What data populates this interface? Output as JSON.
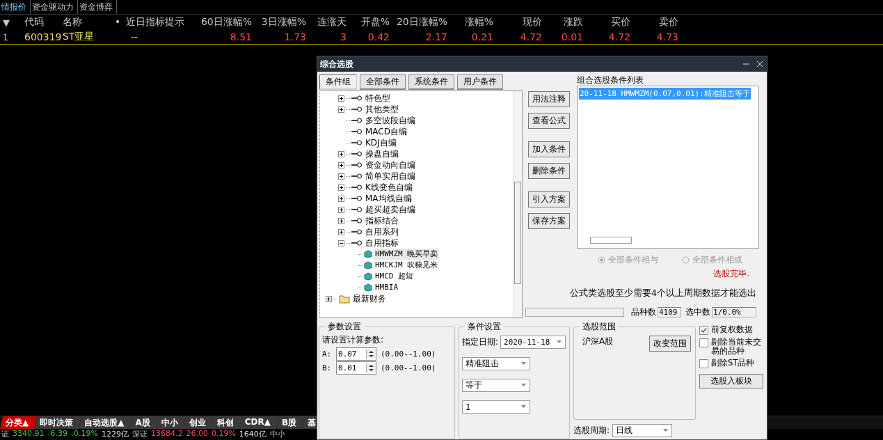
{
  "top_tabs": [
    {
      "label": "情报价",
      "selected": true
    },
    {
      "label": "资金驱动力",
      "selected": false
    },
    {
      "label": "资金博弈",
      "selected": false
    }
  ],
  "table": {
    "sort_marker": "▼",
    "columns": [
      {
        "label": "代码"
      },
      {
        "label": "名称"
      },
      {
        "label": "近日指标提示",
        "marker": "•"
      },
      {
        "label": "60日涨幅%"
      },
      {
        "label": "3日涨幅%"
      },
      {
        "label": "连涨天"
      },
      {
        "label": "开盘%"
      },
      {
        "label": "20日涨幅%"
      },
      {
        "label": "涨幅%"
      },
      {
        "label": "现价"
      },
      {
        "label": "涨跌"
      },
      {
        "label": "买价"
      },
      {
        "label": "卖价"
      }
    ],
    "rows": [
      {
        "index": "1",
        "cells": [
          {
            "text": "600319",
            "kind": "code"
          },
          {
            "text": "ST亚星",
            "kind": "name"
          },
          {
            "text": "--",
            "kind": "hint"
          },
          {
            "text": "8.51",
            "kind": "up"
          },
          {
            "text": "1.73",
            "kind": "up"
          },
          {
            "text": "3",
            "kind": "up"
          },
          {
            "text": "0.42",
            "kind": "up"
          },
          {
            "text": "2.17",
            "kind": "up"
          },
          {
            "text": "0.21",
            "kind": "up"
          },
          {
            "text": "4.72",
            "kind": "up"
          },
          {
            "text": "0.01",
            "kind": "up"
          },
          {
            "text": "4.72",
            "kind": "up"
          },
          {
            "text": "4.73",
            "kind": "up"
          }
        ]
      }
    ]
  },
  "bottom_tabs": [
    {
      "label": "分类▲",
      "selected": true
    },
    {
      "label": "即时决策",
      "selected": false
    },
    {
      "label": "自动选股▲",
      "selected": false
    },
    {
      "label": "A股",
      "selected": false
    },
    {
      "label": "中小",
      "selected": false
    },
    {
      "label": "创业",
      "selected": false
    },
    {
      "label": "科创",
      "selected": false
    },
    {
      "label": "CDR▲",
      "selected": false
    },
    {
      "label": "B股",
      "selected": false
    },
    {
      "label": "基",
      "selected": false
    }
  ],
  "status_bar": [
    {
      "text": "证",
      "kind": "label"
    },
    {
      "text": "3340.91",
      "kind": "down"
    },
    {
      "text": "-6.39",
      "kind": "down"
    },
    {
      "text": "-0.19%",
      "kind": "down"
    },
    {
      "text": "1229亿",
      "kind": "amount"
    },
    {
      "text": "深证",
      "kind": "label"
    },
    {
      "text": "13684.2",
      "kind": "up"
    },
    {
      "text": "26.00",
      "kind": "up"
    },
    {
      "text": "0.19%",
      "kind": "up"
    },
    {
      "text": "1640亿",
      "kind": "amount"
    },
    {
      "text": "中小",
      "kind": "label"
    }
  ],
  "dialog": {
    "title": "综合选股",
    "tabs": [
      {
        "label": "条件组",
        "selected": true
      },
      {
        "label": "全部条件",
        "selected": false
      },
      {
        "label": "系统条件",
        "selected": false
      },
      {
        "label": "用户条件",
        "selected": false
      }
    ],
    "tree": {
      "items": [
        {
          "children": [
            {
              "label": "特色型",
              "kind": "key",
              "expanded": false
            },
            {
              "label": "其他类型",
              "kind": "key",
              "expanded": false
            },
            {
              "label": "多空波段自编",
              "kind": "key"
            },
            {
              "label": "MACD自编",
              "kind": "key"
            },
            {
              "label": "KDJ自编",
              "kind": "key"
            },
            {
              "label": "操盘自编",
              "kind": "key",
              "expanded": false
            },
            {
              "label": "资金动向自编",
              "kind": "key",
              "expanded": false
            },
            {
              "label": "简单实用自编",
              "kind": "key",
              "expanded": false
            },
            {
              "label": "K线变色自编",
              "kind": "key",
              "expanded": false
            },
            {
              "label": "MA均线自编",
              "kind": "key",
              "expanded": false
            },
            {
              "label": "超买超卖自编",
              "kind": "key",
              "expanded": false
            },
            {
              "label": "指标结合",
              "kind": "key",
              "expanded": false
            },
            {
              "label": "自用系列",
              "kind": "key",
              "expanded": false
            },
            {
              "label": "自用指标",
              "kind": "key",
              "expanded": true,
              "children": [
                {
                  "label": "HMWMZM 晚买早卖",
                  "kind": "formula",
                  "selected": true
                },
                {
                  "label": "HMCKJM 吹糠见米",
                  "kind": "formula",
                  "selected": false
                },
                {
                  "label": "HMCD 超短",
                  "kind": "formula",
                  "selected": false
                },
                {
                  "label": "HMBIA",
                  "kind": "formula",
                  "selected": false
                }
              ]
            }
          ]
        },
        {
          "label": "最新财务",
          "kind": "folder",
          "expanded": false
        }
      ]
    },
    "buttons": [
      {
        "label": "用法注释"
      },
      {
        "label": "查看公式"
      },
      {
        "label": "加入条件"
      },
      {
        "label": "删除条件"
      },
      {
        "label": "引入方案"
      },
      {
        "label": "保存方案"
      }
    ],
    "condition_list": {
      "title": "组合选股条件列表",
      "items": [
        {
          "text": "20-11-18 HMWMZM(0.07,0.01):精准阻击等于",
          "selected": true
        }
      ]
    },
    "logic": [
      {
        "label": "全部条件相与",
        "selected": true
      },
      {
        "label": "全部条件相或",
        "selected": false
      }
    ],
    "status": "选股完毕.",
    "note": "公式类选股至少需要4个以上周期数据才能选出",
    "count_label": "品种数",
    "count": "4109",
    "selected_label": "选中数",
    "selected_count": "1/0.0%",
    "params": {
      "title": "参数设置",
      "prompt": "请设置计算参数:",
      "items": [
        {
          "name": "A:",
          "value": "0.07",
          "range": "(0.00--1.00)"
        },
        {
          "name": "B:",
          "value": "0.01",
          "range": "(0.00--1.00)"
        }
      ]
    },
    "conditions": {
      "title": "条件设置",
      "date_label": "指定日期:",
      "date": "2020-11-18",
      "selects": [
        {
          "value": "精准阻击"
        },
        {
          "value": "等于"
        },
        {
          "value": "1"
        }
      ]
    },
    "scope": {
      "title": "选股范围",
      "value": "沪深A股",
      "button": "改变范围",
      "period_label": "选股周期:",
      "period": "日线"
    },
    "options": [
      {
        "label": "前复权数据",
        "checked": true
      },
      {
        "label": "剔除当前未交易的品种",
        "checked": false
      },
      {
        "label": "剔除ST品种",
        "checked": false
      }
    ],
    "to_block_button": "选股入板块"
  }
}
